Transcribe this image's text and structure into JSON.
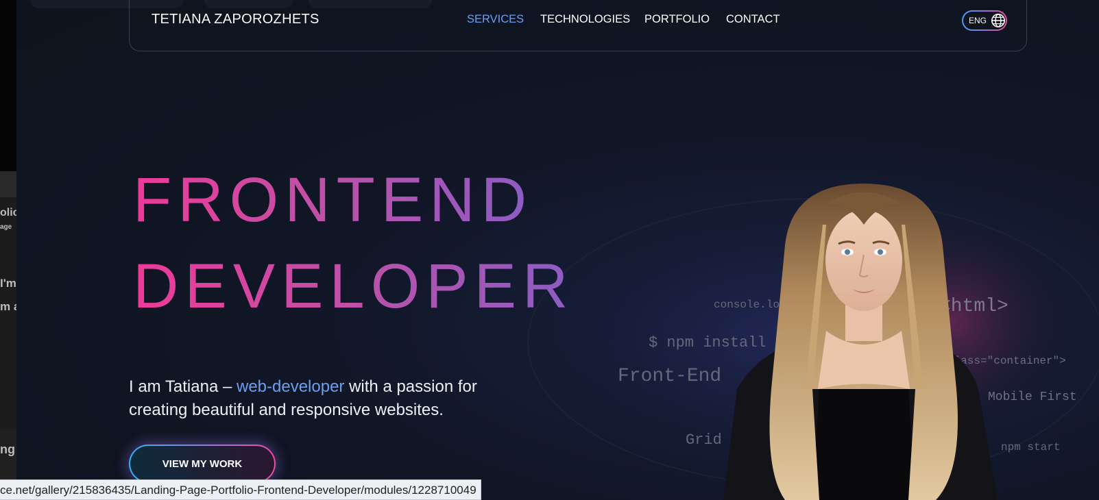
{
  "brand": {
    "name": "TETIANA ZAPOROZHETS"
  },
  "nav": {
    "items": [
      {
        "label": "SERVICES",
        "active": true
      },
      {
        "label": "TECHNOLOGIES",
        "active": false
      },
      {
        "label": "PORTFOLIO",
        "active": false
      },
      {
        "label": "CONTACT",
        "active": false
      }
    ]
  },
  "language": {
    "code": "ENG",
    "icon": "globe-icon"
  },
  "hero": {
    "title_line1": "FRONTEND",
    "title_line2": "DEVELOPER",
    "subtitle_before": "I am Tatiana – ",
    "subtitle_highlight": "web-developer",
    "subtitle_after": " with a passion for creating beautiful and responsive websites.",
    "cta_label": "VIEW MY WORK"
  },
  "code_cloud": [
    "console.log(",
    "<html>",
    "$ npm install",
    "class=\"container\">",
    "Front-End",
    "Mobile First",
    "Grid",
    "npm start"
  ],
  "left_window_fragments": [
    "olio",
    "age",
    "I'm",
    "m a",
    "ng"
  ],
  "status_bar": {
    "url": "ce.net/gallery/215836435/Landing-Page-Portfolio-Frontend-Developer/modules/1228710049"
  },
  "colors": {
    "background": "#10141f",
    "accent_blue": "#6a9ff0",
    "gradient_pink": "#ee3a99",
    "gradient_purple": "#8b5dc4"
  }
}
